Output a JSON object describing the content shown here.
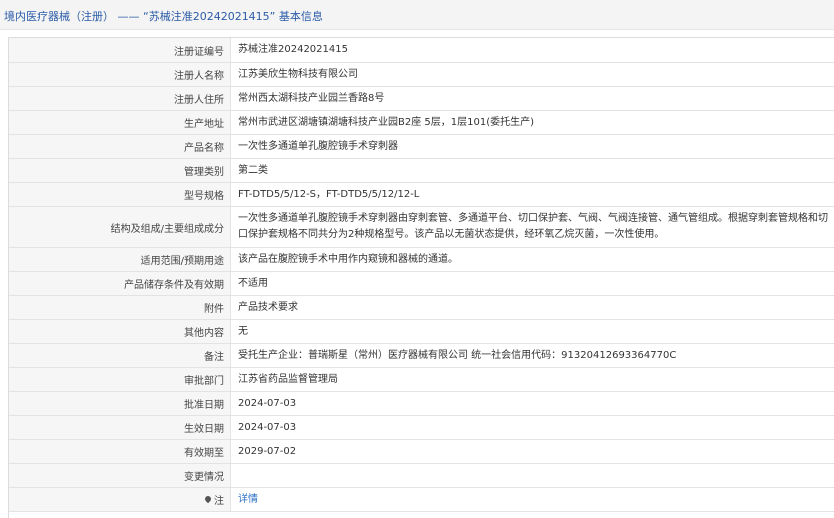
{
  "header": {
    "category": "境内医疗器械（注册）",
    "separator": "——",
    "subject": "“苏械注准20242021415”",
    "suffix": "基本信息"
  },
  "rows": [
    {
      "label": "注册证编号",
      "value": "苏械注准20242021415"
    },
    {
      "label": "注册人名称",
      "value": "江苏美欣生物科技有限公司"
    },
    {
      "label": "注册人住所",
      "value": "常州西太湖科技产业园兰香路8号"
    },
    {
      "label": "生产地址",
      "value": "常州市武进区湖塘镇湖塘科技产业园B2座 5层，1层101(委托生产)"
    },
    {
      "label": "产品名称",
      "value": "一次性多通道单孔腹腔镜手术穿刺器"
    },
    {
      "label": "管理类别",
      "value": "第二类"
    },
    {
      "label": "型号规格",
      "value": "FT-DTD5/5/12-S，FT-DTD5/5/12/12-L"
    },
    {
      "label": "结构及组成/主要组成成分",
      "value": "一次性多通道单孔腹腔镜手术穿刺器由穿刺套管、多通道平台、切口保护套、气阀、气阀连接管、通气管组成。根据穿刺套管规格和切口保护套规格不同共分为2种规格型号。该产品以无菌状态提供，经环氧乙烷灭菌，一次性使用。"
    },
    {
      "label": "适用范围/预期用途",
      "value": "该产品在腹腔镜手术中用作内窥镜和器械的通道。"
    },
    {
      "label": "产品储存条件及有效期",
      "value": "不适用"
    },
    {
      "label": "附件",
      "value": "产品技术要求"
    },
    {
      "label": "其他内容",
      "value": "无"
    },
    {
      "label": "备注",
      "value": "受托生产企业：普瑞斯星（常州）医疗器械有限公司 统一社会信用代码：91320412693364770C"
    },
    {
      "label": "审批部门",
      "value": "江苏省药品监督管理局"
    },
    {
      "label": "批准日期",
      "value": "2024-07-03"
    },
    {
      "label": "生效日期",
      "value": "2024-07-03"
    },
    {
      "label": "有效期至",
      "value": "2029-07-02"
    },
    {
      "label": "变更情况",
      "value": ""
    },
    {
      "label": "注",
      "value": "详情"
    }
  ]
}
